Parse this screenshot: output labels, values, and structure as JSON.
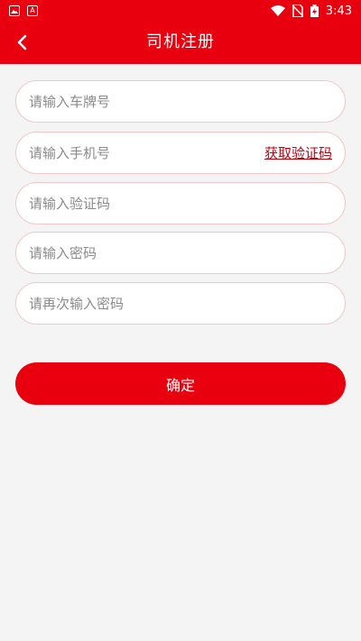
{
  "status_bar": {
    "time": "3:43",
    "icons": [
      "image-icon",
      "a-notification-icon",
      "wifi-icon",
      "no-sim-icon",
      "battery-charging-icon"
    ]
  },
  "header": {
    "title": "司机注册",
    "back_icon": "chevron-left-icon"
  },
  "form": {
    "plate_placeholder": "请输入车牌号",
    "phone_placeholder": "请输入手机号",
    "get_code_label": "获取验证码",
    "code_placeholder": "请输入验证码",
    "password_placeholder": "请输入密码",
    "confirm_password_placeholder": "请再次输入密码"
  },
  "confirm_button": {
    "label": "确定"
  },
  "colors": {
    "brand": "#e8000f",
    "link": "#c10010",
    "background": "#f4f4f4",
    "field_border": "#f0c7c7"
  }
}
